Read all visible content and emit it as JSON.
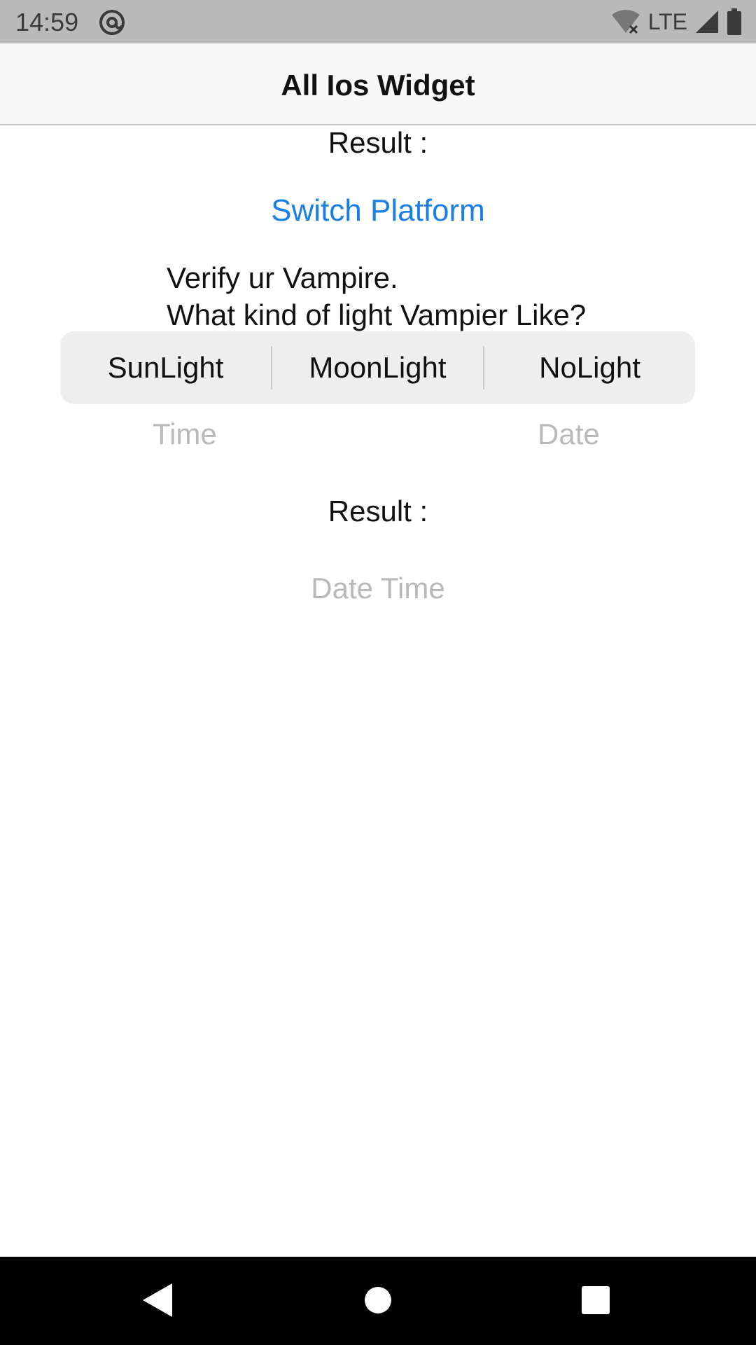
{
  "status_bar": {
    "time": "14:59",
    "network": "LTE",
    "icons": [
      "at-sign-icon",
      "wifi-off-icon",
      "signal-icon",
      "battery-icon"
    ]
  },
  "app_bar": {
    "title": "All Ios Widget"
  },
  "main": {
    "result_top": "Result :",
    "switch_platform": "Switch Platform",
    "question_line1": "Verify ur Vampire.",
    "question_line2": "What kind of light Vampier Like?",
    "segments": [
      "SunLight",
      "MoonLight",
      "NoLight"
    ],
    "time_label": "Time",
    "date_label": "Date",
    "result_bottom": "Result :",
    "datetime_label": "Date Time"
  },
  "nav_bar": {
    "icons": [
      "back-icon",
      "home-icon",
      "recents-icon"
    ]
  },
  "colors": {
    "accent": "#1a7ee6",
    "placeholder": "#b9b9b9",
    "segment_bg": "#eeeeef"
  }
}
